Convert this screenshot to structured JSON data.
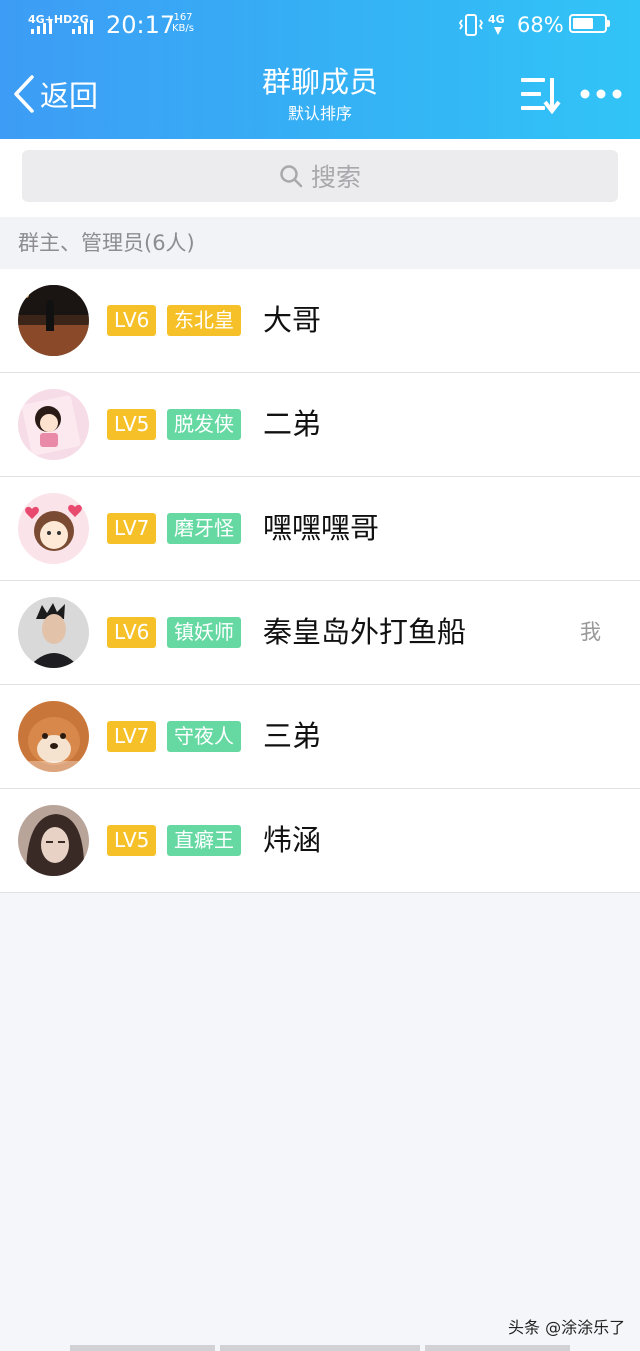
{
  "status_bar": {
    "net1": "4G+HD",
    "net2": "2G",
    "time": "20:17",
    "speed_value": "167",
    "speed_unit": "KB/s",
    "net3": "4G",
    "battery_text": "68%",
    "battery_level": 0.68
  },
  "nav": {
    "back_label": "返回",
    "title": "群聊成员",
    "subtitle": "默认排序"
  },
  "search": {
    "placeholder": "搜索"
  },
  "section": {
    "header": "群主、管理员(6人)"
  },
  "members": [
    {
      "level": "LV6",
      "title": "东北皇",
      "title_color": "#f6c128",
      "name": "大哥",
      "avatar": "night-street-photo",
      "is_me": false
    },
    {
      "level": "LV5",
      "title": "脱发侠",
      "title_color": "#66d9a3",
      "name": "二弟",
      "avatar": "cartoon-girl-pink",
      "is_me": false
    },
    {
      "level": "LV7",
      "title": "磨牙怪",
      "title_color": "#66d9a3",
      "name": "嘿嘿嘿哥",
      "avatar": "cartoon-girl-hearts",
      "is_me": false
    },
    {
      "level": "LV6",
      "title": "镇妖师",
      "title_color": "#66d9a3",
      "name": "秦皇岛外打鱼船",
      "avatar": "man-portrait",
      "is_me": true,
      "me_label": "我"
    },
    {
      "level": "LV7",
      "title": "守夜人",
      "title_color": "#66d9a3",
      "name": "三弟",
      "avatar": "shiba-dog",
      "is_me": false
    },
    {
      "level": "LV5",
      "title": "直癖王",
      "title_color": "#66d9a3",
      "name": "炜涵",
      "avatar": "woman-portrait",
      "is_me": false
    }
  ],
  "watermark": "头条 @涂涂乐了"
}
